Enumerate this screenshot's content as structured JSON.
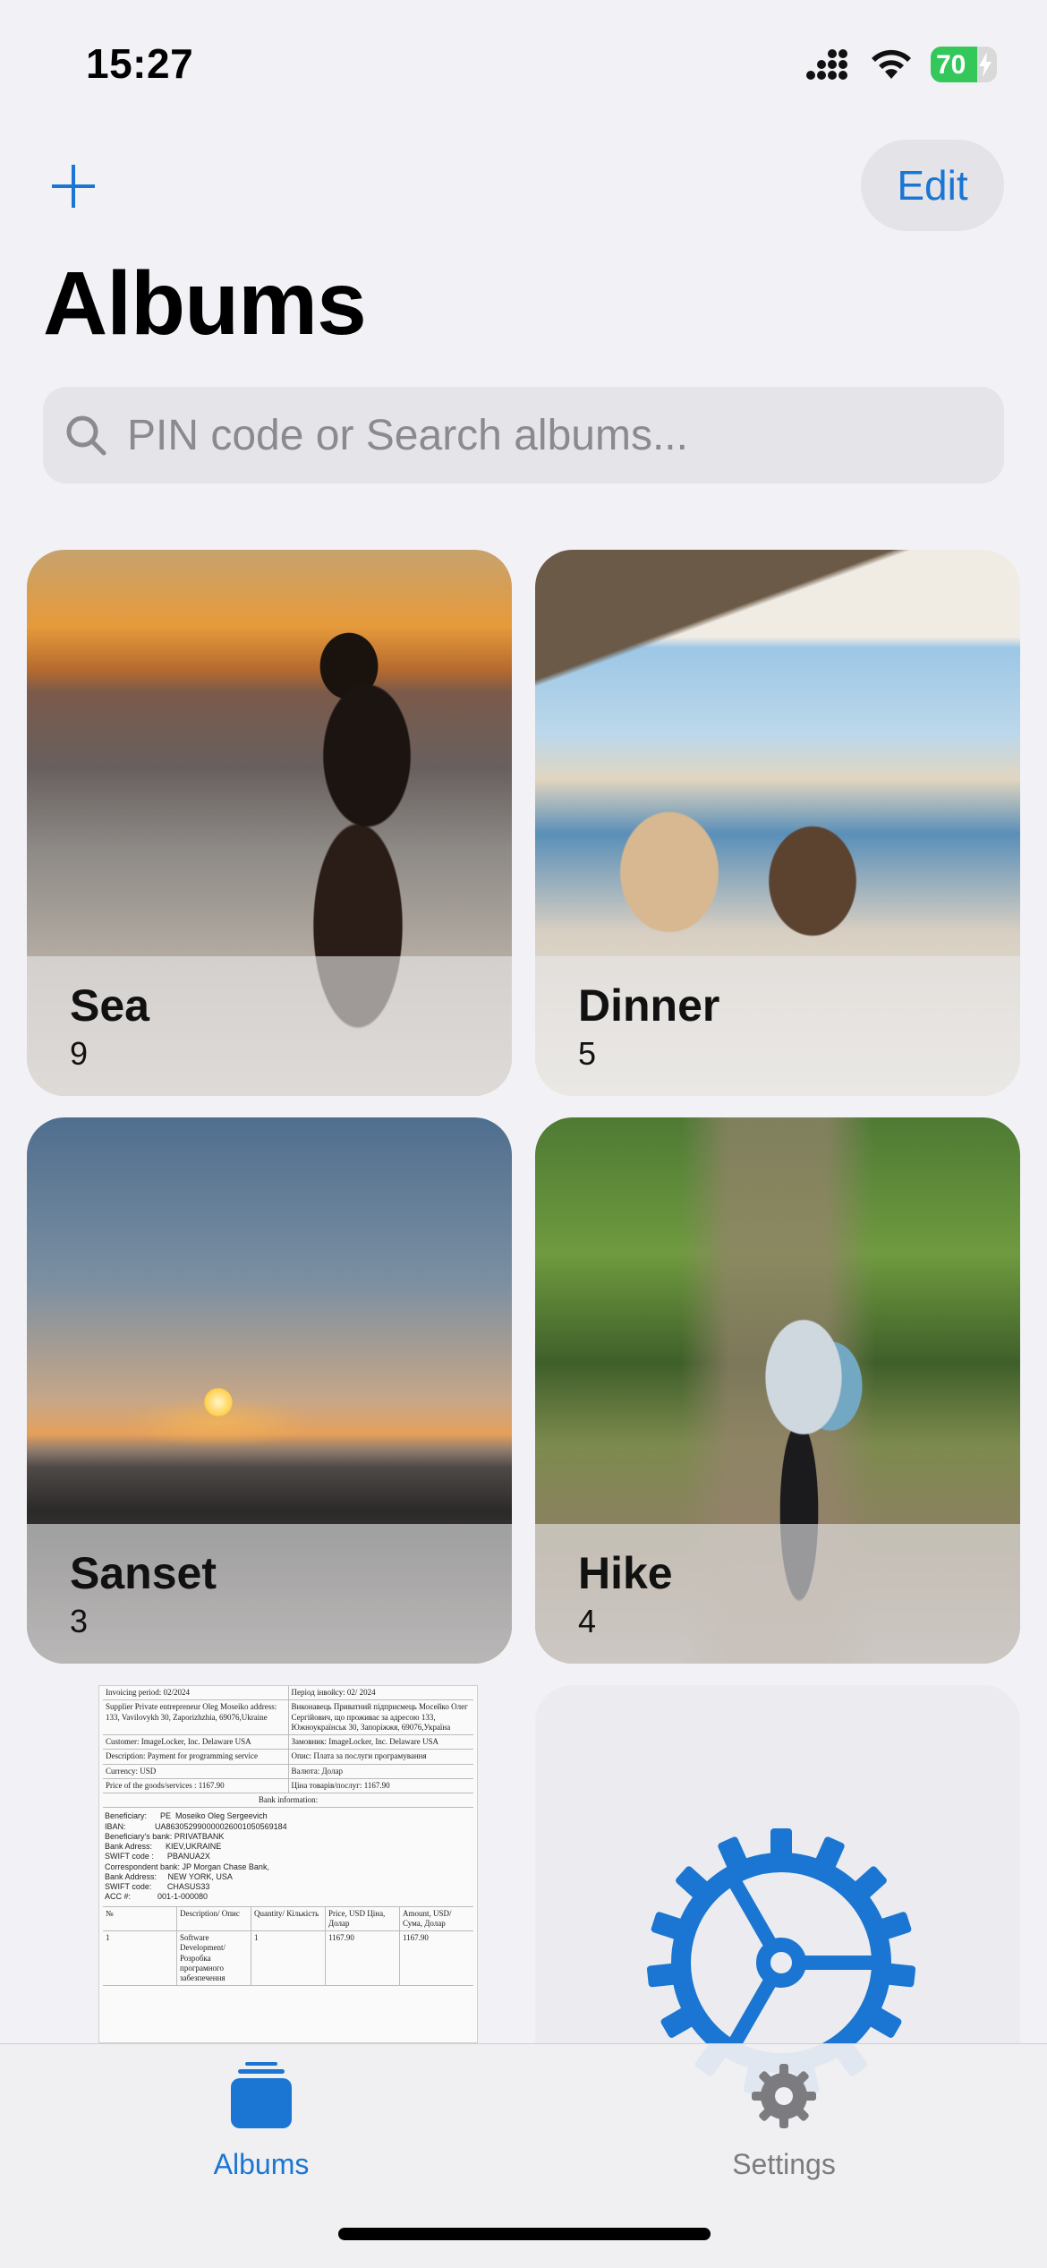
{
  "status_bar": {
    "time": "15:27",
    "battery_percent": "70",
    "battery_level": 0.7,
    "icons": [
      "cellular-signal-icon",
      "wifi-icon",
      "battery-charging-icon"
    ]
  },
  "nav": {
    "add_icon": "plus-icon",
    "edit_label": "Edit",
    "accent_color": "#1a76d2"
  },
  "page": {
    "title": "Albums"
  },
  "search": {
    "icon": "search-icon",
    "placeholder": "PIN code or Search albums..."
  },
  "albums": [
    {
      "name": "Sea",
      "count": "9"
    },
    {
      "name": "Dinner",
      "count": "5"
    },
    {
      "name": "Sanset",
      "count": "3"
    },
    {
      "name": "Hike",
      "count": "4"
    }
  ],
  "invoice_thumbnail": {
    "period_en": "Invoicing period: 02/2024",
    "period_ua": "Період інвойсу: 02/ 2024",
    "supplier_en": "Supplier Private entrepreneur Oleg Moseiko address: 133, Vavilovykh 30, Zaporizhzhia, 69076,Ukraine",
    "supplier_ua": "Виконавець Приватний підприємець Мосейко Олег Сергійович, що проживає за адресою 133, Южноукраїнськ 30, Запоріжжя, 69076,Україна",
    "customer_en": "Customer: ImageLocker, Inc. Delaware USA",
    "customer_ua": "Замовник: ImageLocker, Inc. Delaware USA",
    "description_en": "Description: Payment for programming service",
    "description_ua": "Опис: Плата за послуги програмування",
    "currency_en": "Currency: USD",
    "currency_ua": "Валюта: Долар",
    "price_en": "Price of the goods/services : 1167.90",
    "price_ua": "Ціна товарів/послуг: 1167.90",
    "bank_title": "Bank information:",
    "bank_lines": [
      "Beneficiary:      PE  Moseiko Oleg Sergeevich",
      "IBAN:             UA863052990000026001050569184",
      "Beneficiary's bank: PRIVATBANK",
      "Bank Adress:      KIEV,UKRAINE",
      "SWIFT code :      PBANUA2X",
      "Correspondent bank: JP Morgan Chase Bank,",
      "Bank Address:     NEW YORK, USA",
      "SWIFT code:       CHASUS33",
      "ACC #:            001-1-000080"
    ],
    "table_header": [
      "№",
      "Description/ Опис",
      "Quantity/ Кількість",
      "Price, USD Ціна, Долар",
      "Amount, USD/Сума, Долар"
    ],
    "table_row": [
      "1",
      "Software Development/Розробка програмного забезпечення",
      "1",
      "1167.90",
      "1167.90"
    ]
  },
  "settings_album": {
    "icon": "gear-icon"
  },
  "tab_bar": {
    "tabs": [
      {
        "label": "Albums",
        "icon": "albums-stack-icon",
        "selected": true
      },
      {
        "label": "Settings",
        "icon": "gear-icon",
        "selected": false
      }
    ]
  }
}
